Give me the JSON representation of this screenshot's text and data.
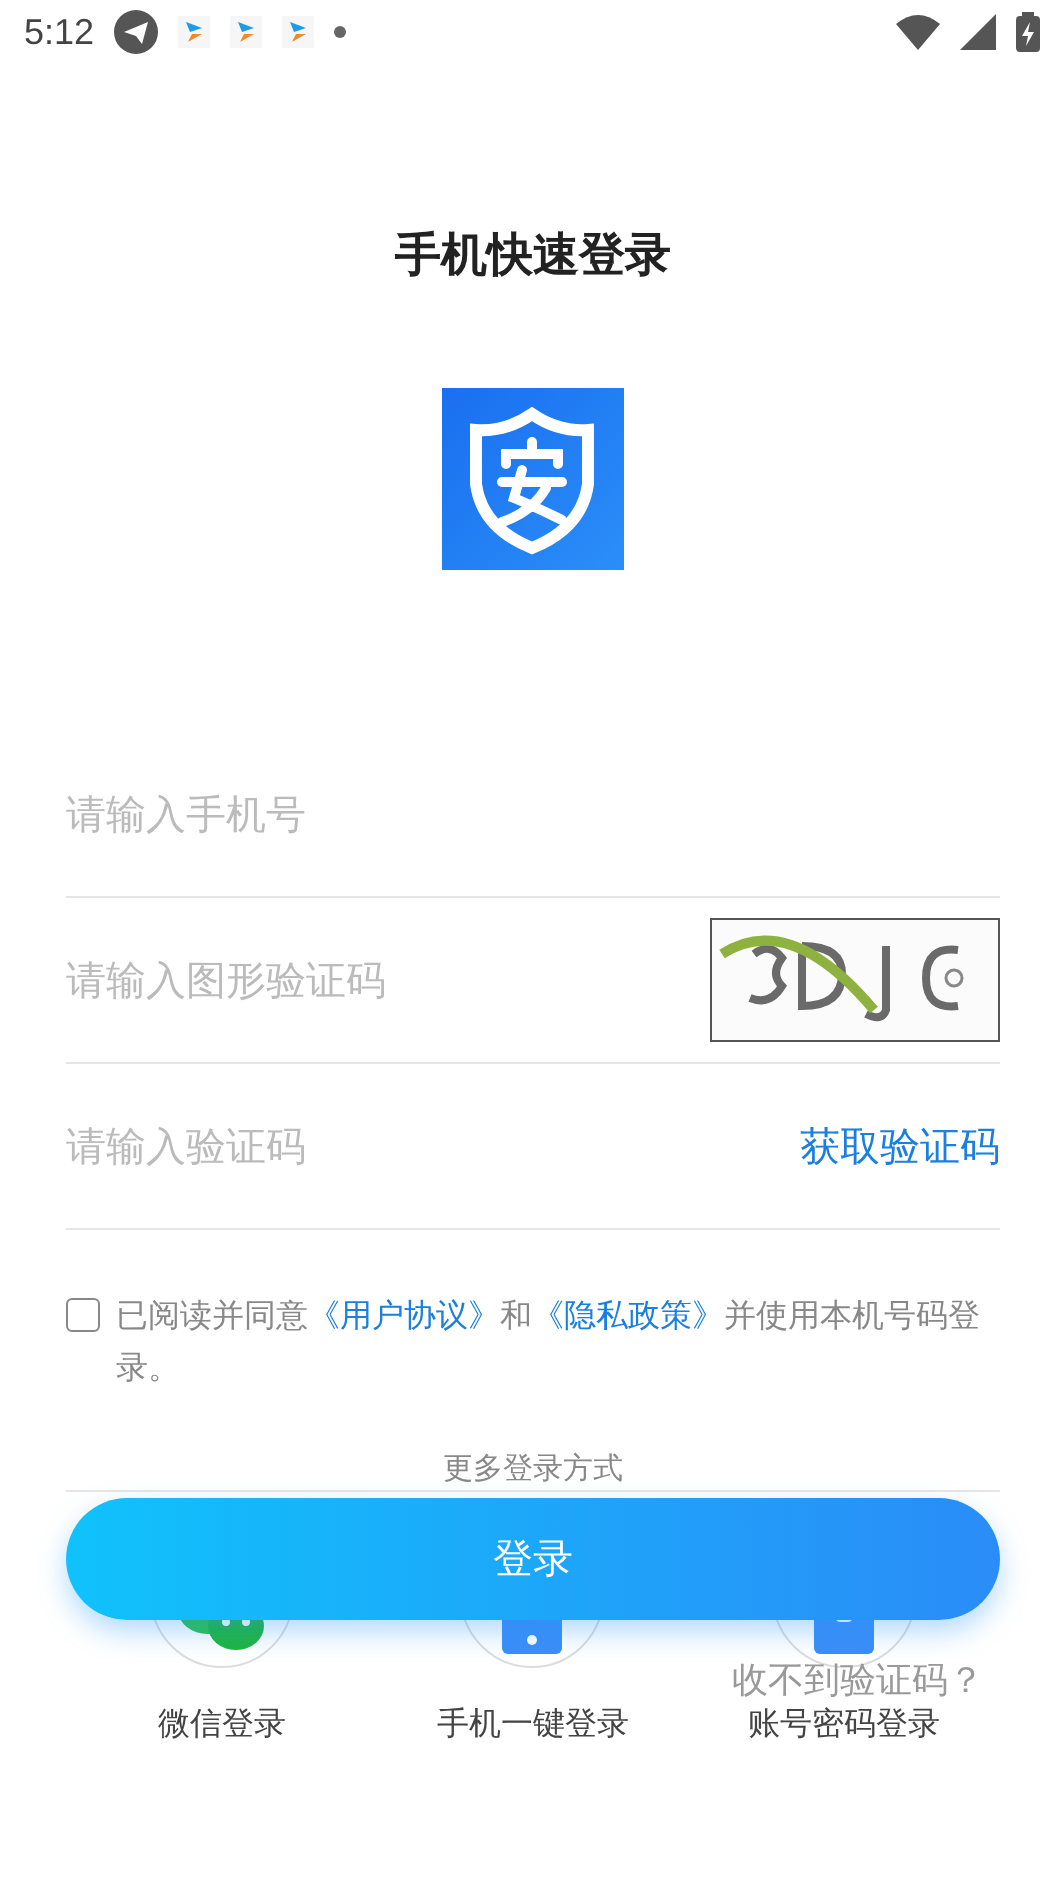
{
  "status_bar": {
    "time": "5:12"
  },
  "title": "手机快速登录",
  "fields": [
    {
      "placeholder": "请输入手机号"
    },
    {
      "placeholder": "请输入图形验证码"
    },
    {
      "placeholder": "请输入验证码",
      "action": "获取验证码"
    }
  ],
  "agreement": {
    "checked": false,
    "parts": [
      {
        "kind": "text",
        "text": "已阅读并同意"
      },
      {
        "kind": "link",
        "text": "《用户协议》"
      },
      {
        "kind": "text",
        "text": "和"
      },
      {
        "kind": "link",
        "text": "《隐私政策》"
      },
      {
        "kind": "text",
        "text": "并使用本机号码登录。"
      }
    ]
  },
  "more_label": "更多登录方式",
  "login_button": "登录",
  "help_link": "收不到验证码？",
  "alt_logins": [
    {
      "kind": "wechat",
      "label": "微信登录"
    },
    {
      "kind": "phone",
      "label": "手机一键登录"
    },
    {
      "kind": "password",
      "label": "账号密码登录"
    }
  ]
}
